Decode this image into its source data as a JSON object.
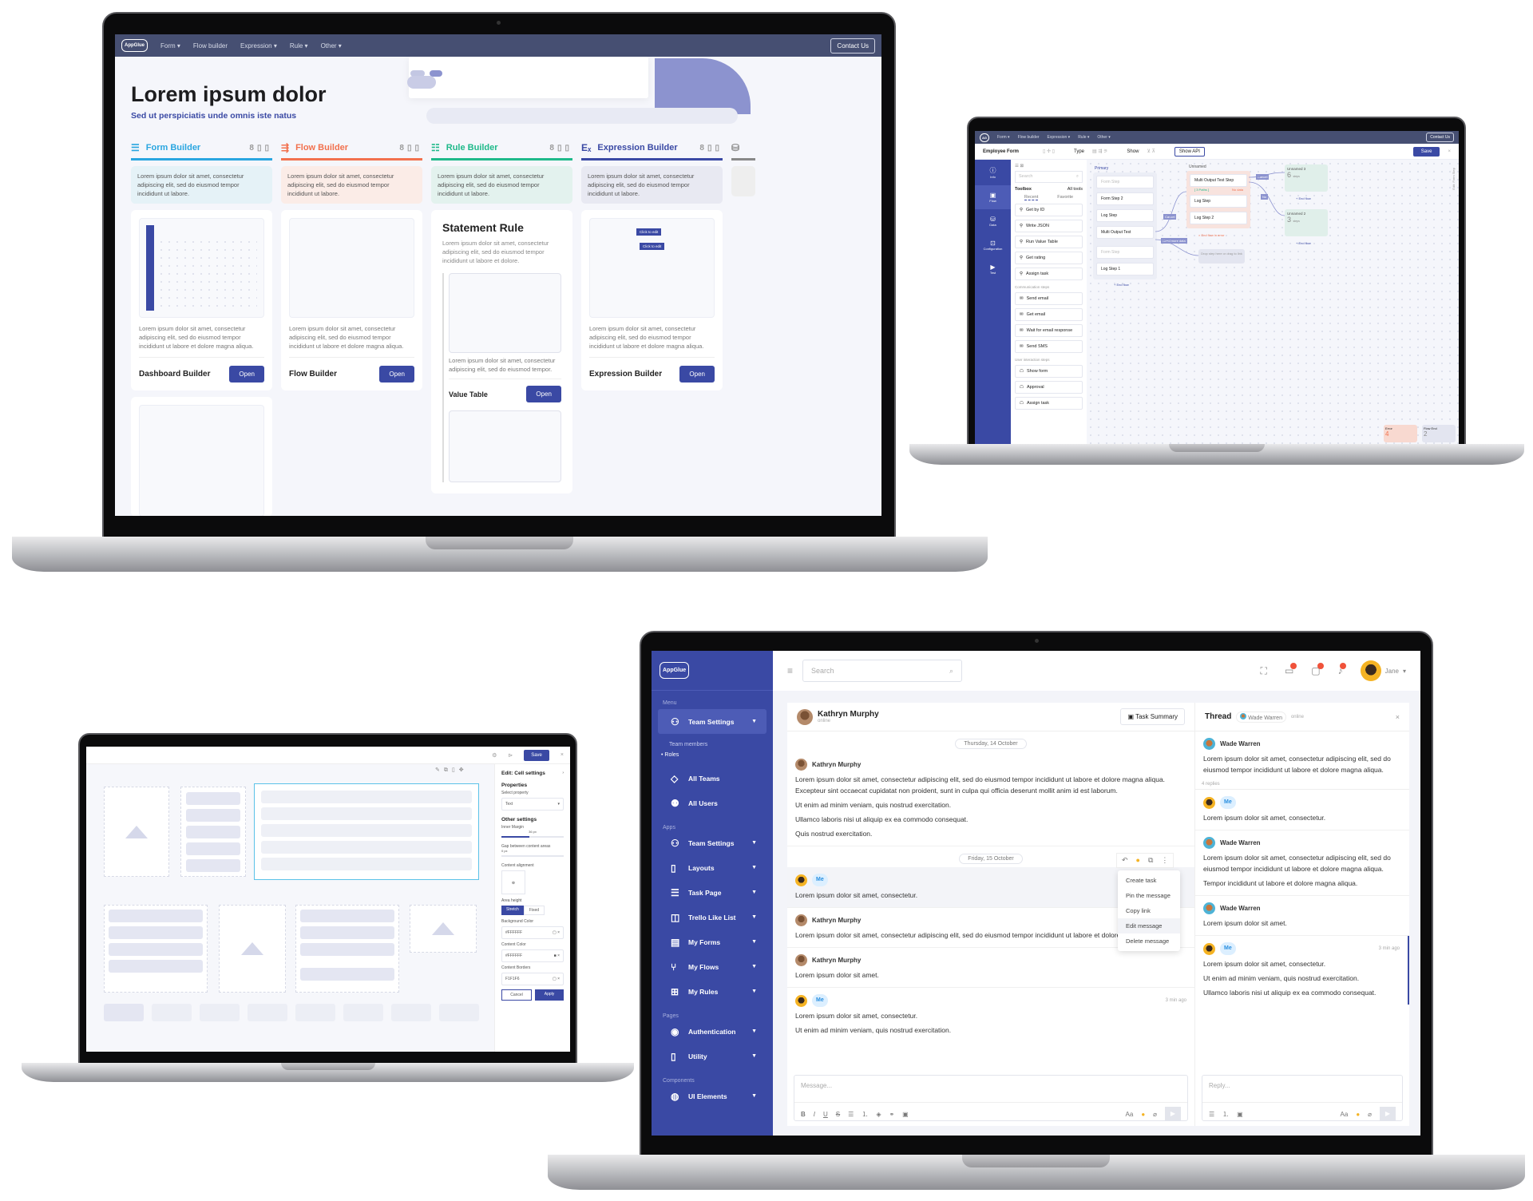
{
  "laptop1": {
    "nav": {
      "logo": "AppGlue",
      "items": [
        "Form ▾",
        "Flow builder",
        "Expression ▾",
        "Rule ▾",
        "Other ▾"
      ],
      "contact": "Contact Us"
    },
    "hero": {
      "title": "Lorem ipsum dolor",
      "subtitle": "Sed ut perspiciatis unde omnis iste natus"
    },
    "columns": [
      {
        "title": "Form Builder",
        "icon": "form-icon",
        "color": "#2aa6e0",
        "desc": "Lorem ipsum dolor sit amet, consectetur adipiscing elit, sed do eiusmod tempor incididunt ut labore.",
        "card_text": "Lorem ipsum dolor sit amet, consectetur adipiscing elit, sed do eiusmod tempor incididunt ut labore et dolore magna aliqua.",
        "card_title": "Dashboard Builder",
        "button": "Open",
        "count": "8"
      },
      {
        "title": "Flow Builder",
        "icon": "flow-icon",
        "color": "#f2714e",
        "desc": "Lorem ipsum dolor sit amet, consectetur adipiscing elit, sed do eiusmod tempor incididunt ut labore.",
        "card_text": "Lorem ipsum dolor sit amet, consectetur adipiscing elit, sed do eiusmod tempor incididunt ut labore et dolore magna aliqua.",
        "card_title": "Flow Builder",
        "button": "Open",
        "count": "8"
      },
      {
        "title": "Rule Builder",
        "icon": "rule-icon",
        "color": "#1fb98a",
        "desc": "Lorem ipsum dolor sit amet, consectetur adipiscing elit, sed do eiusmod tempor incididunt ut labore.",
        "heading": "Statement Rule",
        "heading_text": "Lorem ipsum dolor sit amet, consectetur adipiscing elit, sed do eiusmod tempor incididunt ut labore et dolore.",
        "card_text": "Lorem ipsum dolor sit amet, consectetur adipiscing elit, sed do eiusmod tempor.",
        "card_title": "Value Table",
        "button": "Open",
        "count": "8"
      },
      {
        "title": "Expression Builder",
        "icon": "expression-icon",
        "color": "#3a49a4",
        "desc": "Lorem ipsum dolor sit amet, consectetur adipiscing elit, sed do eiusmod tempor incididunt ut labore.",
        "card_text": "Lorem ipsum dolor sit amet, consectetur adipiscing elit, sed do eiusmod tempor incididunt ut labore et dolore magna aliqua.",
        "card_title": "Expression Builder",
        "button": "Open",
        "count": "8",
        "chip": "Click to edit"
      }
    ]
  },
  "laptop2": {
    "nav": {
      "items": [
        "Form ▾",
        "Flow builder",
        "Expression ▾",
        "Rule ▾",
        "Other ▾"
      ],
      "contact": "Contact Us"
    },
    "toolbar": {
      "title": "Employee Form",
      "type_label": "Type",
      "show_label": "Show",
      "show_api": "Show API",
      "save": "Save"
    },
    "sidebar": [
      "Info",
      "Flow",
      "Data",
      "Configuration",
      "Test"
    ],
    "toolbox": {
      "search": "Search",
      "title": "Toolbox",
      "all_tools": "All tools",
      "tabs": [
        "Recent",
        "Favorite"
      ],
      "recent": [
        "Get by ID",
        "Write JSON",
        "Run Value Table",
        "Get rating",
        "Assign task"
      ],
      "comm_label": "Communication steps",
      "comm": [
        "Send email",
        "Get email",
        "Wait for email response",
        "Send SMS"
      ],
      "ui_label": "User interaction steps",
      "ui": [
        "Show form",
        "Approval",
        "Assign task"
      ]
    },
    "canvas": {
      "primary": {
        "label": "Primary",
        "steps": [
          "Form Step",
          "Form Step 2",
          "Log Step",
          "Multi Output Test",
          "Form Step",
          "Log Step 1"
        ],
        "end": "+ End flow"
      },
      "unnamed": {
        "label": "Unnamed",
        "steps": [
          "Multi Output Test Step",
          "Log Step",
          "Log Step 2"
        ],
        "paths": "[ 3 Paths ]",
        "nodata": "No data",
        "end": "× End flow in error"
      },
      "links": [
        "Cancel",
        "No",
        "Cancel",
        "Need more data"
      ],
      "unnamed3": {
        "label": "Unnamed 3",
        "count": "6",
        "unit": "steps",
        "end": "+ End flow"
      },
      "unnamed2": {
        "label": "Unnamed 2",
        "count": "3",
        "unit": "steps",
        "end": "+ End flow"
      },
      "drop": "Drop step here or drag to link",
      "error": {
        "label": "Error",
        "count": "4"
      },
      "flowend": {
        "label": "Flow End",
        "count": "2"
      },
      "side_label": "Edit: Form Step"
    }
  },
  "laptop3": {
    "top": {
      "save": "Save"
    },
    "panel": {
      "title": "Edit: Cell settings",
      "properties": "Properties",
      "select_property": "Select property",
      "property_value": "Text",
      "other": "Other settings",
      "inner_margin": "Inner Margin",
      "inner_margin_value": "36 px",
      "gap": "Gap between content areas",
      "gap_value": "0 px",
      "alignment": "Content alignment",
      "area_height": "Area height",
      "area_options": [
        "Stretch",
        "Fixed"
      ],
      "bg_label": "Background Color",
      "bg_value": "#FFFFFF",
      "content_label": "Content Color",
      "content_value": "#FFFFFF",
      "border_label": "Content Borders",
      "border_value": "F1F1F6",
      "cancel": "Cancel",
      "apply": "Apply"
    }
  },
  "laptop4": {
    "logo": "AppGlue",
    "search_placeholder": "Search",
    "user": "Jane",
    "sidebar": {
      "menu_label": "Menu",
      "active": "Team Settings",
      "sub": [
        "Team members",
        "Roles"
      ],
      "menu": [
        {
          "label": "All Teams",
          "icon": "diamond-icon"
        },
        {
          "label": "All Users",
          "icon": "users-icon"
        }
      ],
      "apps_label": "Apps",
      "apps": [
        "Team Settings",
        "Layouts",
        "Task Page",
        "Trello Like List",
        "My Forms",
        "My Flows",
        "My Rules"
      ],
      "pages_label": "Pages",
      "pages": [
        "Authentication",
        "Utility"
      ],
      "components_label": "Components",
      "components": [
        "UI Elements"
      ]
    },
    "chat": {
      "contact": "Kathryn Murphy",
      "status": "online",
      "task_summary": "Task Summary",
      "date1": "Thursday, 14 October",
      "date2": "Friday, 15 October",
      "messages": [
        {
          "author": "Kathryn Murphy",
          "lines": [
            "Lorem ipsum dolor sit amet, consectetur adipiscing elit, sed do eiusmod tempor incididunt ut labore et dolore magna aliqua. Excepteur sint occaecat cupidatat non proident, sunt in culpa qui officia deserunt mollit anim id est laborum.",
            "Ut enim ad minim veniam, quis nostrud exercitation.",
            "Ullamco laboris nisi ut aliquip ex ea commodo consequat.",
            "Quis nostrud exercitation."
          ]
        },
        {
          "author": "Me",
          "lines": [
            "Lorem ipsum dolor sit amet, consectetur."
          ]
        },
        {
          "author": "Kathryn Murphy",
          "lines": [
            "Lorem ipsum dolor sit amet, consectetur adipiscing elit, sed do eiusmod tempor incididunt ut labore et dolore magna aliqua."
          ]
        },
        {
          "author": "Kathryn Murphy",
          "lines": [
            "Lorem ipsum dolor sit amet."
          ]
        },
        {
          "author": "Me",
          "time": "3 min ago",
          "lines": [
            "Lorem ipsum dolor sit amet, consectetur.",
            "Ut enim ad minim veniam, quis nostrud exercitation."
          ]
        }
      ],
      "menu": [
        "Create task",
        "Pin the message",
        "Copy link",
        "Edit message",
        "Delete message"
      ],
      "composer_placeholder": "Message...",
      "font_label": "Aa"
    },
    "thread": {
      "title": "Thread",
      "contact": "Wade Warren",
      "status": "online",
      "replies": "4 replies",
      "messages": [
        {
          "author": "Wade Warren",
          "lines": [
            "Lorem ipsum dolor sit amet, consectetur adipiscing elit, sed do eiusmod tempor incididunt ut labore et dolore magna aliqua."
          ]
        },
        {
          "author": "Me",
          "lines": [
            "Lorem ipsum dolor sit amet, consectetur."
          ]
        },
        {
          "author": "Wade Warren",
          "lines": [
            "Lorem ipsum dolor sit amet, consectetur adipiscing elit, sed do eiusmod tempor incididunt ut labore et dolore magna aliqua.",
            "Tempor incididunt ut labore et dolore magna aliqua."
          ]
        },
        {
          "author": "Wade Warren",
          "lines": [
            "Lorem ipsum dolor sit amet."
          ]
        },
        {
          "author": "Me",
          "time": "3 min ago",
          "lines": [
            "Lorem ipsum dolor sit amet, consectetur.",
            "Ut enim ad minim veniam, quis nostrud exercitation.",
            "Ullamco laboris nisi ut aliquip ex ea commodo consequat."
          ]
        }
      ],
      "reply_placeholder": "Reply...",
      "font_label": "Aa"
    }
  }
}
